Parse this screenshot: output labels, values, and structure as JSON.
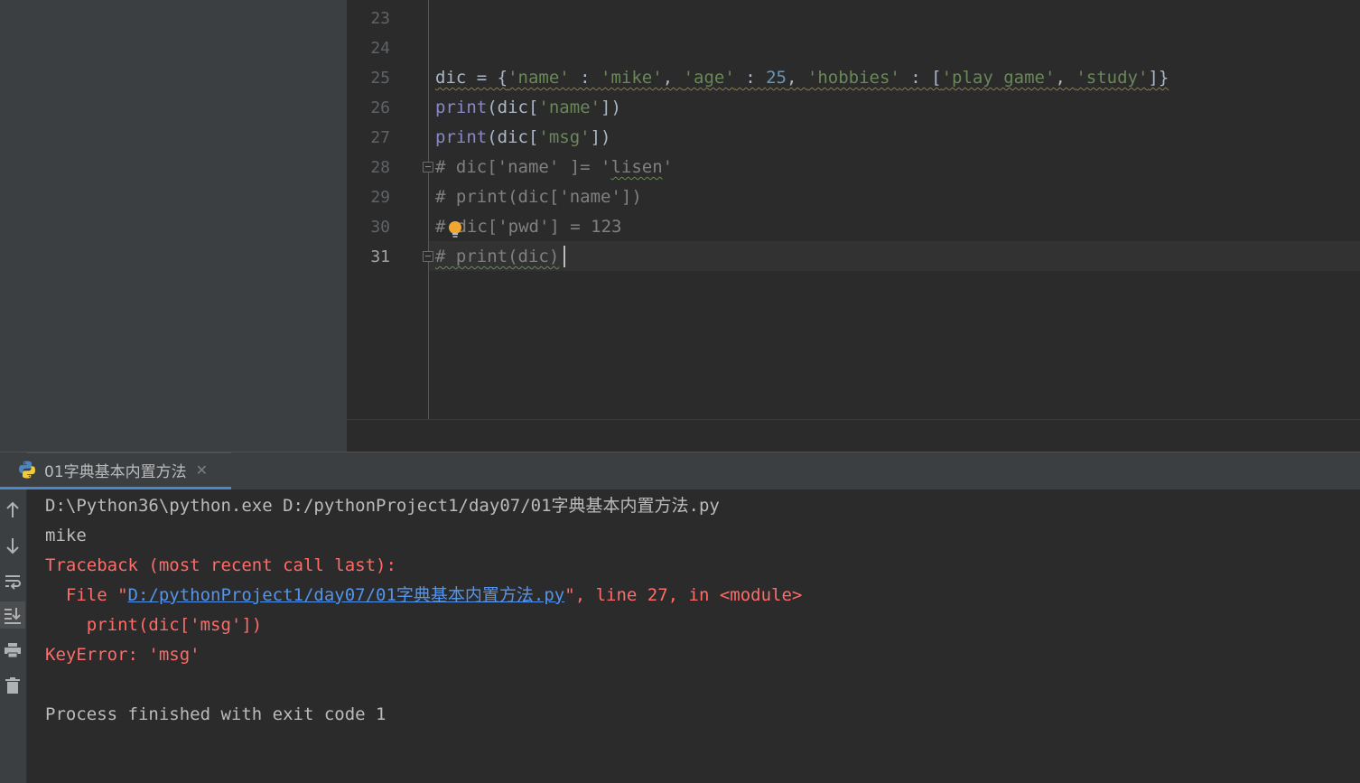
{
  "editor": {
    "line_numbers": [
      "23",
      "24",
      "25",
      "26",
      "27",
      "28",
      "29",
      "30",
      "31"
    ],
    "current_line": "31",
    "lines": {
      "l25": {
        "a": "dic = {",
        "b": "'name'",
        "c": " : ",
        "d": "'mike'",
        "e": ", ",
        "f": "'age'",
        "g": " : ",
        "h": "25",
        "i": ", ",
        "j": "'hobbies'",
        "k": " : [",
        "l": "'play game'",
        "m": ", ",
        "n": "'study'",
        "o": "]}"
      },
      "l26": {
        "fn": "print",
        "a": "(dic[",
        "s": "'name'",
        "b": "])"
      },
      "l27": {
        "fn": "print",
        "a": "(dic[",
        "s": "'msg'",
        "b": "])"
      },
      "l28": {
        "a": "# dic['name' ]= '",
        "t": "lisen",
        "b": "'"
      },
      "l29": "# print(dic['name'])",
      "l30": {
        "a": "#",
        "b": "dic['pwd'] = 123"
      },
      "l31": "# print(dic)"
    }
  },
  "run": {
    "tab_label": "01字典基本内置方法",
    "icons": {
      "tab": "python-icon",
      "close": "close-icon",
      "toolbar": [
        "arrow-up-icon",
        "arrow-down-icon",
        "soft-wrap-icon",
        "scroll-to-end-icon",
        "print-icon",
        "trash-icon"
      ]
    }
  },
  "console": {
    "cmd": "D:\\Python36\\python.exe D:/pythonProject1/day07/01字典基本内置方法.py",
    "out1": "mike",
    "tb_header": "Traceback (most recent call last):",
    "tb_file_prefix": "  File \"",
    "tb_file_link": "D:/pythonProject1/day07/01字典基本内置方法.py",
    "tb_file_suffix": "\", line 27, in <module>",
    "tb_code": "    print(dic['msg'])",
    "error": "KeyError: 'msg'",
    "exit": "Process finished with exit code 1"
  },
  "colors": {
    "editor_bg": "#2b2b2b",
    "panel_bg": "#3c3f41",
    "string": "#6a8759",
    "number": "#6897bb",
    "builtin": "#8888c6",
    "comment": "#808080",
    "error": "#ff6b68",
    "link": "#5394ec",
    "tab_underline": "#4a88c7"
  }
}
